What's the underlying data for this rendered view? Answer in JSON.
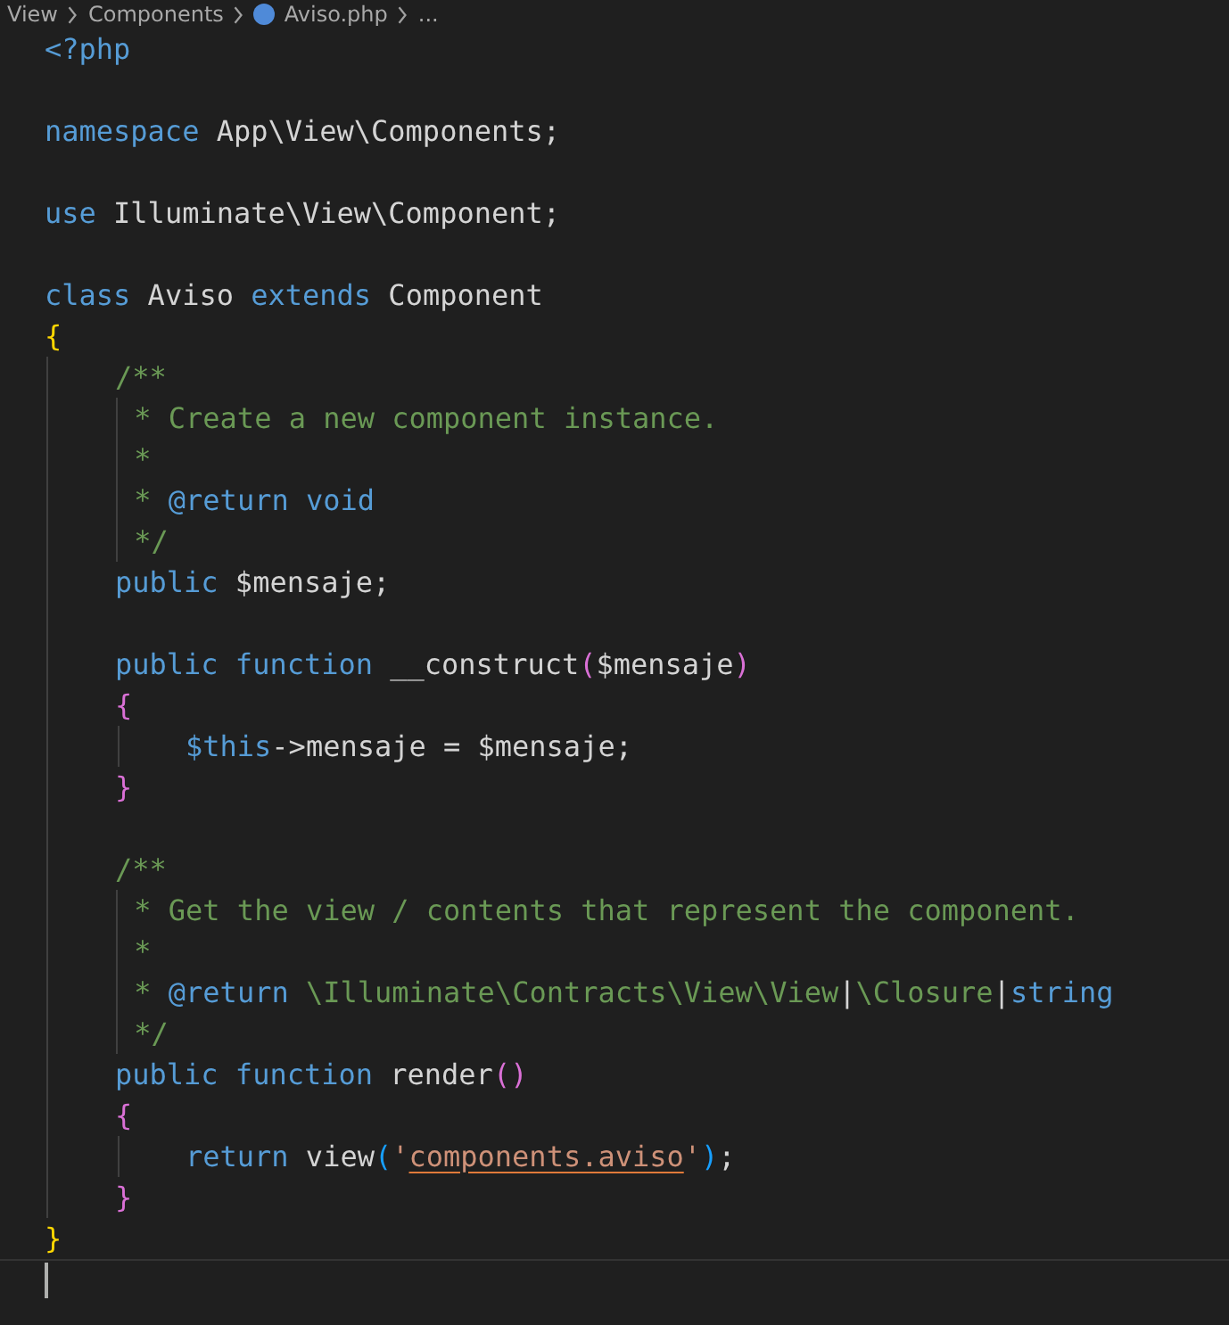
{
  "breadcrumb": [
    {
      "label": "View",
      "kind": "folder"
    },
    {
      "label": "Components",
      "kind": "folder"
    },
    {
      "label": "Aviso.php",
      "kind": "file"
    },
    {
      "label": "...",
      "kind": "more"
    }
  ],
  "lines": [
    {
      "kind": "code",
      "tokens": [
        {
          "text": "<?php",
          "kind": "keyword"
        }
      ]
    },
    {
      "kind": "blank"
    },
    {
      "kind": "code",
      "tokens": [
        {
          "text": "namespace",
          "kind": "keyword"
        },
        {
          "text": " App\\View\\Components;",
          "kind": "plain"
        }
      ]
    },
    {
      "kind": "blank"
    },
    {
      "kind": "code",
      "tokens": [
        {
          "text": "use",
          "kind": "keyword"
        },
        {
          "text": " Illuminate\\View\\Component;",
          "kind": "plain"
        }
      ]
    },
    {
      "kind": "blank"
    },
    {
      "kind": "code",
      "tokens": [
        {
          "text": "class",
          "kind": "keyword"
        },
        {
          "text": " Aviso ",
          "kind": "plain"
        },
        {
          "text": "extends",
          "kind": "keyword"
        },
        {
          "text": " Component",
          "kind": "plain"
        }
      ]
    },
    {
      "kind": "code",
      "tokens": [
        {
          "text": "{",
          "kind": "bracket1"
        }
      ],
      "children": [
        {
          "kind": "code",
          "tokens": [
            {
              "text": "/**",
              "kind": "comment"
            }
          ]
        },
        {
          "kind": "doc",
          "tokens": [
            {
              "text": " * Create a new component instance.",
              "kind": "comment"
            }
          ]
        },
        {
          "kind": "doc",
          "tokens": [
            {
              "text": " *",
              "kind": "comment"
            }
          ]
        },
        {
          "kind": "doc",
          "tokens": [
            {
              "text": " * ",
              "kind": "comment"
            },
            {
              "text": "@return void",
              "kind": "keyword"
            }
          ]
        },
        {
          "kind": "doc",
          "tokens": [
            {
              "text": " */",
              "kind": "comment"
            }
          ]
        },
        {
          "kind": "code",
          "tokens": [
            {
              "text": "public",
              "kind": "keyword"
            },
            {
              "text": " $mensaje;",
              "kind": "plain"
            }
          ]
        },
        {
          "kind": "blank"
        },
        {
          "kind": "code",
          "tokens": [
            {
              "text": "public function",
              "kind": "keyword"
            },
            {
              "text": " __construct",
              "kind": "plain"
            },
            {
              "text": "(",
              "kind": "bracket2"
            },
            {
              "text": "$mensaje",
              "kind": "plain"
            },
            {
              "text": ")",
              "kind": "bracket2"
            }
          ]
        },
        {
          "kind": "code",
          "tokens": [
            {
              "text": "{",
              "kind": "bracket2"
            }
          ],
          "children": [
            {
              "kind": "code",
              "tokens": [
                {
                  "text": "$this",
                  "kind": "keyword"
                },
                {
                  "text": "->mensaje = $mensaje;",
                  "kind": "plain"
                }
              ]
            }
          ]
        },
        {
          "kind": "code",
          "tokens": [
            {
              "text": "}",
              "kind": "bracket2"
            }
          ]
        },
        {
          "kind": "blank"
        },
        {
          "kind": "code",
          "tokens": [
            {
              "text": "/**",
              "kind": "comment"
            }
          ]
        },
        {
          "kind": "doc",
          "tokens": [
            {
              "text": " * Get the view / contents that represent the component.",
              "kind": "comment"
            }
          ]
        },
        {
          "kind": "doc",
          "tokens": [
            {
              "text": " *",
              "kind": "comment"
            }
          ]
        },
        {
          "kind": "doc",
          "tokens": [
            {
              "text": " * ",
              "kind": "comment"
            },
            {
              "text": "@return",
              "kind": "keyword"
            },
            {
              "text": " \\Illuminate\\Contracts\\View\\View",
              "kind": "comment"
            },
            {
              "text": "|",
              "kind": "plain"
            },
            {
              "text": "\\Closure",
              "kind": "comment"
            },
            {
              "text": "|",
              "kind": "plain"
            },
            {
              "text": "string",
              "kind": "keyword"
            }
          ]
        },
        {
          "kind": "doc",
          "tokens": [
            {
              "text": " */",
              "kind": "comment"
            }
          ]
        },
        {
          "kind": "code",
          "tokens": [
            {
              "text": "public function",
              "kind": "keyword"
            },
            {
              "text": " render",
              "kind": "plain"
            },
            {
              "text": "()",
              "kind": "bracket2"
            }
          ]
        },
        {
          "kind": "code",
          "tokens": [
            {
              "text": "{",
              "kind": "bracket2"
            }
          ],
          "children": [
            {
              "kind": "code",
              "tokens": [
                {
                  "text": "return",
                  "kind": "keyword"
                },
                {
                  "text": " view",
                  "kind": "plain"
                },
                {
                  "text": "(",
                  "kind": "bracket3"
                },
                {
                  "text": "'",
                  "kind": "string"
                },
                {
                  "text": "components.aviso",
                  "kind": "link"
                },
                {
                  "text": "'",
                  "kind": "string"
                },
                {
                  "text": ")",
                  "kind": "bracket3"
                },
                {
                  "text": ";",
                  "kind": "plain"
                }
              ]
            }
          ]
        },
        {
          "kind": "code",
          "tokens": [
            {
              "text": "}",
              "kind": "bracket2"
            }
          ]
        }
      ]
    },
    {
      "kind": "code",
      "tokens": [
        {
          "text": "}",
          "kind": "bracket1"
        }
      ]
    },
    {
      "kind": "cursor"
    }
  ]
}
